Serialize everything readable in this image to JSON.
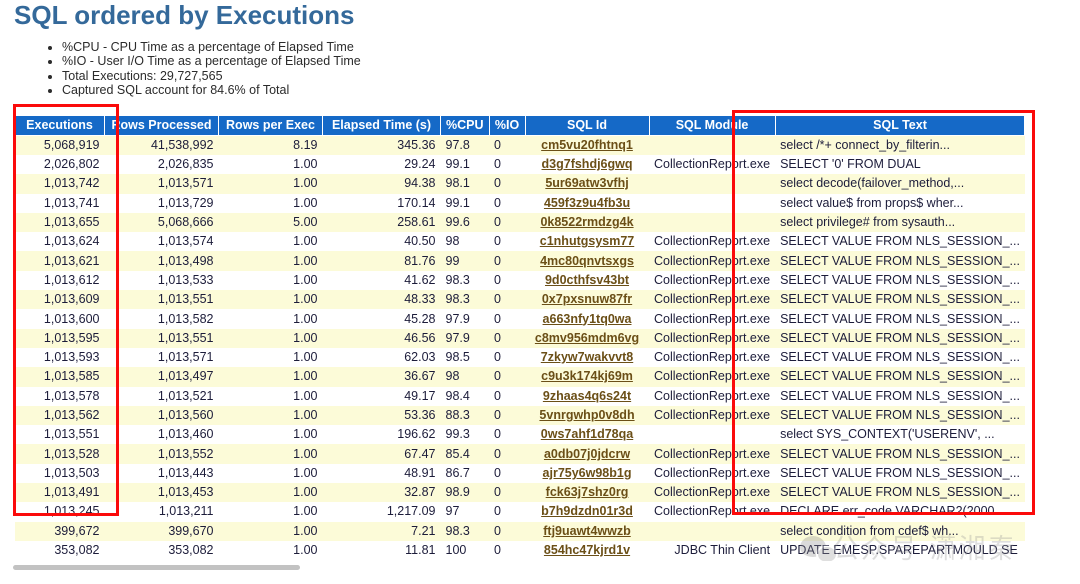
{
  "page_title": "SQL ordered by Executions",
  "notes": [
    "%CPU - CPU Time as a percentage of Elapsed Time",
    "%IO - User I/O Time as a percentage of Elapsed Time",
    "Total Executions: 29,727,565",
    "Captured SQL account for 84.6% of Total"
  ],
  "colors": {
    "title": "#34699a",
    "header_bg": "#1569c7",
    "header_fg": "#ffffff",
    "row_odd_bg": "#fcfbd8",
    "row_even_bg": "#ffffff",
    "link": "#6b4f17",
    "annotation": "#fb0a0a"
  },
  "table": {
    "columns": [
      "Executions",
      "Rows Processed",
      "Rows per Exec",
      "Elapsed Time (s)",
      "%CPU",
      "%IO",
      "SQL Id",
      "SQL Module",
      "SQL Text"
    ],
    "rows": [
      {
        "executions": "5,068,919",
        "rows_processed": "41,538,992",
        "rows_per_exec": "8.19",
        "elapsed": "345.36",
        "cpu": "97.8",
        "io": "0",
        "sql_id": "cm5vu20fhtnq1",
        "module": "",
        "sql_text": "select /*+ connect_by_filterin..."
      },
      {
        "executions": "2,026,802",
        "rows_processed": "2,026,835",
        "rows_per_exec": "1.00",
        "elapsed": "29.24",
        "cpu": "99.1",
        "io": "0",
        "sql_id": "d3g7fshdj6gwq",
        "module": "CollectionReport.exe",
        "sql_text": "SELECT '0' FROM DUAL"
      },
      {
        "executions": "1,013,742",
        "rows_processed": "1,013,571",
        "rows_per_exec": "1.00",
        "elapsed": "94.38",
        "cpu": "98.1",
        "io": "0",
        "sql_id": "5ur69atw3vfhj",
        "module": "",
        "sql_text": "select decode(failover_method,..."
      },
      {
        "executions": "1,013,741",
        "rows_processed": "1,013,729",
        "rows_per_exec": "1.00",
        "elapsed": "170.14",
        "cpu": "99.1",
        "io": "0",
        "sql_id": "459f3z9u4fb3u",
        "module": "",
        "sql_text": "select value$ from props$ wher..."
      },
      {
        "executions": "1,013,655",
        "rows_processed": "5,068,666",
        "rows_per_exec": "5.00",
        "elapsed": "258.61",
        "cpu": "99.6",
        "io": "0",
        "sql_id": "0k8522rmdzg4k",
        "module": "",
        "sql_text": "select privilege# from sysauth..."
      },
      {
        "executions": "1,013,624",
        "rows_processed": "1,013,574",
        "rows_per_exec": "1.00",
        "elapsed": "40.50",
        "cpu": "98",
        "io": "0",
        "sql_id": "c1nhutgsysm77",
        "module": "CollectionReport.exe",
        "sql_text": "SELECT VALUE FROM NLS_SESSION_..."
      },
      {
        "executions": "1,013,621",
        "rows_processed": "1,013,498",
        "rows_per_exec": "1.00",
        "elapsed": "81.76",
        "cpu": "99",
        "io": "0",
        "sql_id": "4mc80qnvtsxgs",
        "module": "CollectionReport.exe",
        "sql_text": "SELECT VALUE FROM NLS_SESSION_..."
      },
      {
        "executions": "1,013,612",
        "rows_processed": "1,013,533",
        "rows_per_exec": "1.00",
        "elapsed": "41.62",
        "cpu": "98.3",
        "io": "0",
        "sql_id": "9d0cthfsv43bt",
        "module": "CollectionReport.exe",
        "sql_text": "SELECT VALUE FROM NLS_SESSION_..."
      },
      {
        "executions": "1,013,609",
        "rows_processed": "1,013,551",
        "rows_per_exec": "1.00",
        "elapsed": "48.33",
        "cpu": "98.3",
        "io": "0",
        "sql_id": "0x7pxsnuw87fr",
        "module": "CollectionReport.exe",
        "sql_text": "SELECT VALUE FROM NLS_SESSION_..."
      },
      {
        "executions": "1,013,600",
        "rows_processed": "1,013,582",
        "rows_per_exec": "1.00",
        "elapsed": "45.28",
        "cpu": "97.9",
        "io": "0",
        "sql_id": "a663nfy1tq0wa",
        "module": "CollectionReport.exe",
        "sql_text": "SELECT VALUE FROM NLS_SESSION_..."
      },
      {
        "executions": "1,013,595",
        "rows_processed": "1,013,551",
        "rows_per_exec": "1.00",
        "elapsed": "46.56",
        "cpu": "97.9",
        "io": "0",
        "sql_id": "c8mv956mdm6vg",
        "module": "CollectionReport.exe",
        "sql_text": "SELECT VALUE FROM NLS_SESSION_..."
      },
      {
        "executions": "1,013,593",
        "rows_processed": "1,013,571",
        "rows_per_exec": "1.00",
        "elapsed": "62.03",
        "cpu": "98.5",
        "io": "0",
        "sql_id": "7zkyw7wakvvt8",
        "module": "CollectionReport.exe",
        "sql_text": "SELECT VALUE FROM NLS_SESSION_..."
      },
      {
        "executions": "1,013,585",
        "rows_processed": "1,013,497",
        "rows_per_exec": "1.00",
        "elapsed": "36.67",
        "cpu": "98",
        "io": "0",
        "sql_id": "c9u3k174kj69m",
        "module": "CollectionReport.exe",
        "sql_text": "SELECT VALUE FROM NLS_SESSION_..."
      },
      {
        "executions": "1,013,578",
        "rows_processed": "1,013,521",
        "rows_per_exec": "1.00",
        "elapsed": "49.17",
        "cpu": "98.4",
        "io": "0",
        "sql_id": "9zhaas4q6s24t",
        "module": "CollectionReport.exe",
        "sql_text": "SELECT VALUE FROM NLS_SESSION_..."
      },
      {
        "executions": "1,013,562",
        "rows_processed": "1,013,560",
        "rows_per_exec": "1.00",
        "elapsed": "53.36",
        "cpu": "88.3",
        "io": "0",
        "sql_id": "5vnrgwhp0v8dh",
        "module": "CollectionReport.exe",
        "sql_text": "SELECT VALUE FROM NLS_SESSION_..."
      },
      {
        "executions": "1,013,551",
        "rows_processed": "1,013,460",
        "rows_per_exec": "1.00",
        "elapsed": "196.62",
        "cpu": "99.3",
        "io": "0",
        "sql_id": "0ws7ahf1d78qa",
        "module": "",
        "sql_text": "select SYS_CONTEXT('USERENV', ..."
      },
      {
        "executions": "1,013,528",
        "rows_processed": "1,013,552",
        "rows_per_exec": "1.00",
        "elapsed": "67.47",
        "cpu": "85.4",
        "io": "0",
        "sql_id": "a0db07j0jdcrw",
        "module": "CollectionReport.exe",
        "sql_text": "SELECT VALUE FROM NLS_SESSION_..."
      },
      {
        "executions": "1,013,503",
        "rows_processed": "1,013,443",
        "rows_per_exec": "1.00",
        "elapsed": "48.91",
        "cpu": "86.7",
        "io": "0",
        "sql_id": "ajr75y6w98b1g",
        "module": "CollectionReport.exe",
        "sql_text": "SELECT VALUE FROM NLS_SESSION_..."
      },
      {
        "executions": "1,013,491",
        "rows_processed": "1,013,453",
        "rows_per_exec": "1.00",
        "elapsed": "32.87",
        "cpu": "98.9",
        "io": "0",
        "sql_id": "fck63j7shz0rg",
        "module": "CollectionReport.exe",
        "sql_text": "SELECT VALUE FROM NLS_SESSION_..."
      },
      {
        "executions": "1,013,245",
        "rows_processed": "1,013,211",
        "rows_per_exec": "1.00",
        "elapsed": "1,217.09",
        "cpu": "97",
        "io": "0",
        "sql_id": "b7h9dzdn01r3d",
        "module": "CollectionReport.exe",
        "sql_text": "DECLARE err_code VARCHAR2(2000..."
      },
      {
        "executions": "399,672",
        "rows_processed": "399,670",
        "rows_per_exec": "1.00",
        "elapsed": "7.21",
        "cpu": "98.3",
        "io": "0",
        "sql_id": "ftj9uawt4wwzb",
        "module": "",
        "sql_text": "select condition from cdef$ wh..."
      },
      {
        "executions": "353,082",
        "rows_processed": "353,082",
        "rows_per_exec": "1.00",
        "elapsed": "11.81",
        "cpu": "100",
        "io": "0",
        "sql_id": "854hc47kjrd1v",
        "module": "JDBC Thin Client",
        "sql_text": "UPDATE EMESP.SPAREPARTMOULD SE"
      }
    ]
  },
  "annotations": [
    {
      "name": "executions-column-highlight"
    },
    {
      "name": "sql-text-column-highlight"
    }
  ],
  "watermark": {
    "text": "公众号 潇湘秦"
  }
}
